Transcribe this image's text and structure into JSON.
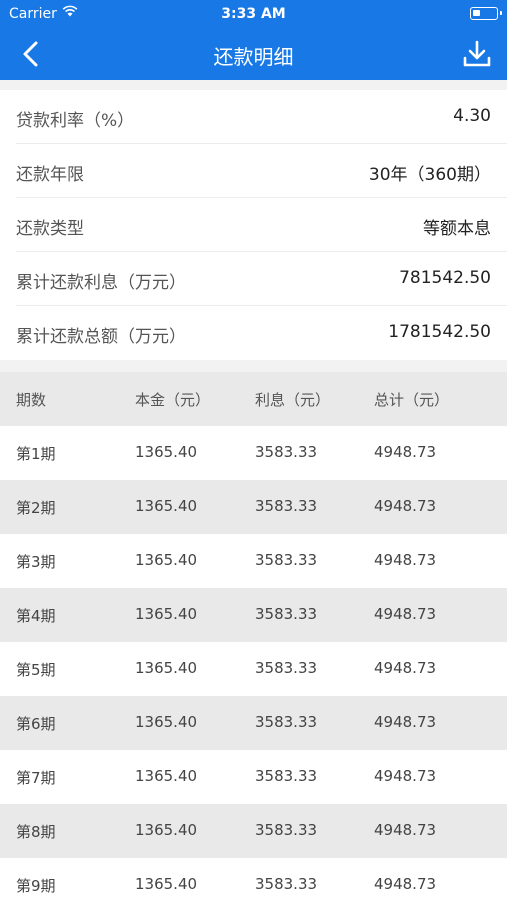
{
  "status_bar": {
    "carrier": "Carrier",
    "time": "3:33 AM"
  },
  "nav": {
    "title": "还款明细",
    "back_icon": "chevron-left-icon",
    "download_icon": "download-icon"
  },
  "colors": {
    "brand": "#1778e6",
    "row_alt": "#e9e9e9"
  },
  "summary": [
    {
      "label": "贷款利率（%）",
      "value": "4.30"
    },
    {
      "label": "还款年限",
      "value": "30年（360期）"
    },
    {
      "label": "还款类型",
      "value": "等额本息"
    },
    {
      "label": "累计还款利息（万元）",
      "value": "781542.50"
    },
    {
      "label": "累计还款总额（万元）",
      "value": "1781542.50"
    }
  ],
  "table": {
    "headers": [
      "期数",
      "本金（元）",
      "利息（元）",
      "总计（元）"
    ],
    "rows": [
      [
        "第1期",
        "1365.40",
        "3583.33",
        "4948.73"
      ],
      [
        "第2期",
        "1365.40",
        "3583.33",
        "4948.73"
      ],
      [
        "第3期",
        "1365.40",
        "3583.33",
        "4948.73"
      ],
      [
        "第4期",
        "1365.40",
        "3583.33",
        "4948.73"
      ],
      [
        "第5期",
        "1365.40",
        "3583.33",
        "4948.73"
      ],
      [
        "第6期",
        "1365.40",
        "3583.33",
        "4948.73"
      ],
      [
        "第7期",
        "1365.40",
        "3583.33",
        "4948.73"
      ],
      [
        "第8期",
        "1365.40",
        "3583.33",
        "4948.73"
      ],
      [
        "第9期",
        "1365.40",
        "3583.33",
        "4948.73"
      ]
    ]
  }
}
